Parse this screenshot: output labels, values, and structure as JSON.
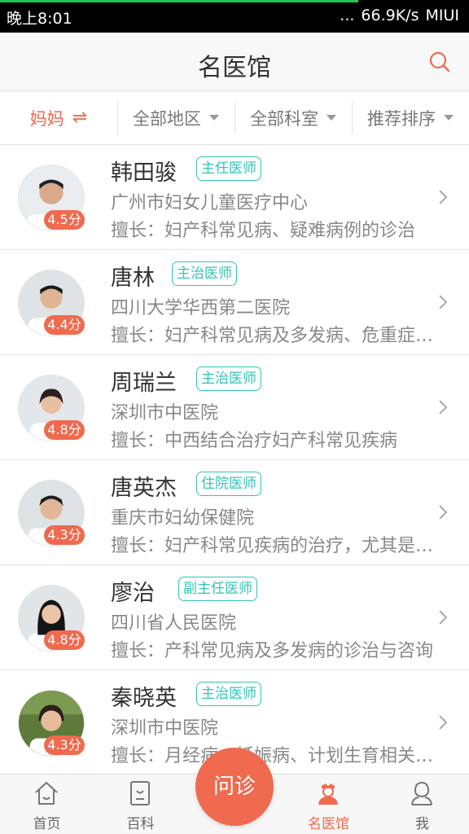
{
  "status_bar": {
    "time": "晚上8:01",
    "network_speed": "66.9K/s",
    "dots": "...",
    "carrier": "MIUI"
  },
  "nav": {
    "title": "名医馆",
    "search_icon": "search-icon"
  },
  "filters": {
    "mode": "妈妈",
    "mode_icon": "⇌",
    "region": "全部地区",
    "department": "全部科室",
    "sort": "推荐排序"
  },
  "doctors": [
    {
      "name": "韩田骏",
      "title": "主任医师",
      "rating": "4.5分",
      "hospital": "广州市妇女儿童医疗中心",
      "specialty": "擅长：妇产科常见病、疑难病例的诊治"
    },
    {
      "name": "唐林",
      "title": "主治医师",
      "rating": "4.4分",
      "hospital": "四川大学华西第二医院",
      "specialty": "擅长：妇产科常见病及多发病、危重症的诊治"
    },
    {
      "name": "周瑞兰",
      "title": "主治医师",
      "rating": "4.8分",
      "hospital": "深圳市中医院",
      "specialty": "擅长：中西结合治疗妇产科常见疾病"
    },
    {
      "name": "唐英杰",
      "title": "住院医师",
      "rating": "4.3分",
      "hospital": "重庆市妇幼保健院",
      "specialty": "擅长：妇产科常见疾病的治疗，尤其是孕期保健"
    },
    {
      "name": "廖治",
      "title": "副主任医师",
      "rating": "4.8分",
      "hospital": "四川省人民医院",
      "specialty": "擅长：产科常见病及多发病的诊治与咨询"
    },
    {
      "name": "秦晓英",
      "title": "主治医师",
      "rating": "4.3分",
      "hospital": "深圳市中医院",
      "specialty": "擅长：月经病、妊娠病、计划生育相关咨询"
    }
  ],
  "tabs": {
    "home": "首页",
    "encyclopedia": "百科",
    "consult": "问诊",
    "doctors": "名医馆",
    "me": "我"
  },
  "colors": {
    "accent": "#ef6a4f",
    "badge": "#31c4b7"
  }
}
